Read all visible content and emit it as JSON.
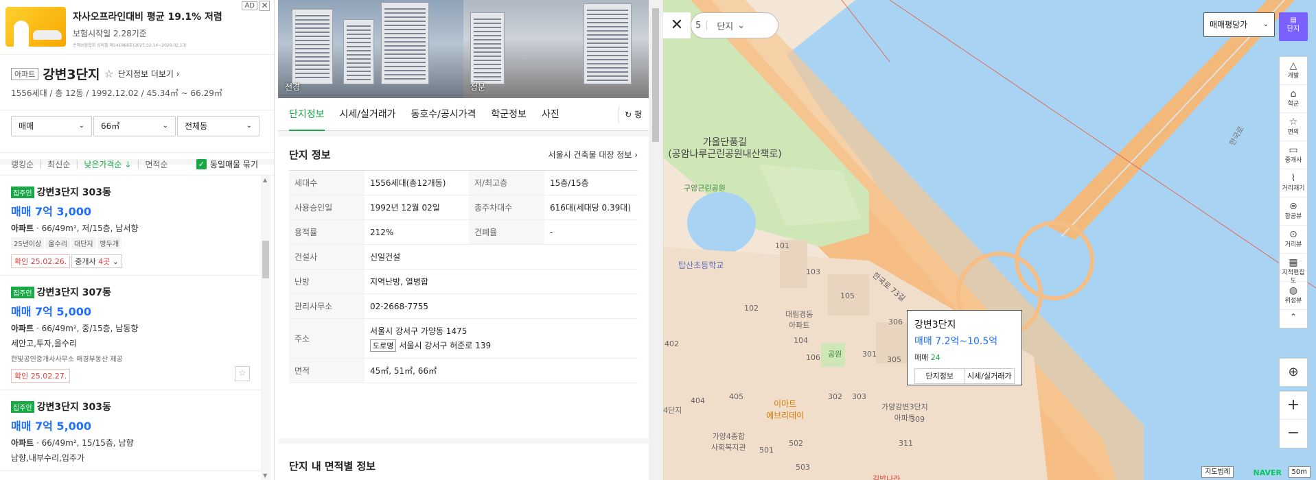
{
  "ad": {
    "title": "자사오프라인대비 평균 19.1% 저렴",
    "subtitle": "보험시작일 2.28기준",
    "fineprint": "손해보험협회 심의필 제141868호(2025.02.14~2026.02.13)",
    "badge": "AD",
    "close": "✕"
  },
  "complex": {
    "type_tag": "아파트",
    "name": "강변3단지",
    "star": "☆",
    "more_link": "단지정보 더보기 ›",
    "spec": "1556세대 / 총 12동 / 1992.12.02 / 45.34㎡ ~ 66.29㎡"
  },
  "filters": {
    "trade": "매매",
    "area": "66㎡",
    "building": "전체동",
    "chevron": "⌄"
  },
  "sort": {
    "ranking": "랭킹순",
    "recent": "최신순",
    "low_price": "낮은가격순 ↓",
    "area_sort": "면적순",
    "group_label": "동일매물 묶기",
    "check": "✓"
  },
  "listings": [
    {
      "owner": "집주인",
      "title": "강변3단지 303동",
      "price": "매매 7억 3,000",
      "spec_type": "아파트",
      "spec": " · 66/49m², 저/15층, 남서향",
      "tags": [
        "25년이상",
        "올수리",
        "대단지",
        "방두개"
      ],
      "desc": "",
      "agent": "",
      "confirm": "확인 25.02.26.",
      "broker_pre": "중개사 ",
      "broker_count": "4곳",
      "broker_post": " ⌄",
      "fav": ""
    },
    {
      "owner": "집주인",
      "title": "강변3단지 307동",
      "price": "매매 7억 5,000",
      "spec_type": "아파트",
      "spec": " · 66/49m², 중/15층, 남동향",
      "tags": [],
      "desc": "세안고,투자,올수리",
      "agent": "한빛공인중개사사무소    매경부동산 제공",
      "confirm": "확인 25.02.27.",
      "broker_pre": "",
      "broker_count": "",
      "broker_post": "",
      "fav": "☆"
    },
    {
      "owner": "집주인",
      "title": "강변3단지 303동",
      "price": "매매 7억 5,000",
      "spec_type": "아파트",
      "spec": " · 66/49m², 15/15층, 남향",
      "tags": [],
      "desc": "남향,내부수리,입주가",
      "agent": "",
      "confirm": "",
      "broker_pre": "",
      "broker_count": "",
      "broker_post": "",
      "fav": ""
    }
  ],
  "photos": [
    {
      "caption": "전경"
    },
    {
      "caption": "정문"
    }
  ],
  "tabs": [
    "단지정보",
    "시세/실거래가",
    "동호수/공시가격",
    "학군정보",
    "사진"
  ],
  "refresh_label": "↻ 평",
  "info": {
    "heading": "단지 정보",
    "link": "서울시 건축물 대장 정보 ›",
    "rows": [
      {
        "k1": "세대수",
        "v1": "1556세대(총12개동)",
        "k2": "저/최고층",
        "v2": "15층/15층"
      },
      {
        "k1": "사용승인일",
        "v1": "1992년 12월 02일",
        "k2": "총주차대수",
        "v2": "616대(세대당 0.39대)"
      },
      {
        "k1": "용적률",
        "v1": "212%",
        "k2": "건폐율",
        "v2": "-"
      },
      {
        "k1": "건설사",
        "v1": "신일건설"
      },
      {
        "k1": "난방",
        "v1": "지역난방, 열병합"
      },
      {
        "k1": "관리사무소",
        "v1": "02-2668-7755"
      },
      {
        "k1": "주소",
        "v1": "서울시 강서구 가양동 1475",
        "road_tag": "도로명",
        "v1b": "서울시 강서구 허준로 139"
      },
      {
        "k1": "면적",
        "v1": "45㎡, 51㎡, 66㎡"
      }
    ]
  },
  "area_section": {
    "heading": "단지 내 면적별 정보"
  },
  "map": {
    "close": "✕",
    "filter_partial": "5",
    "filter_danji": "단지",
    "chevron": "⌄",
    "price_select": "매매평당가",
    "danji_btn": "단지",
    "tools": [
      {
        "icon": "△",
        "label": "개발"
      },
      {
        "icon": "⌂",
        "label": "학군"
      },
      {
        "icon": "☆",
        "label": "편의"
      },
      {
        "icon": "▭",
        "label": "중개사"
      },
      {
        "icon": "⌇",
        "label": "거리재기"
      },
      {
        "icon": "⊜",
        "label": "항공뷰"
      },
      {
        "icon": "⊙",
        "label": "거리뷰"
      },
      {
        "icon": "▦",
        "label": "지적편집도"
      },
      {
        "icon": "◍",
        "label": "위성뷰"
      },
      {
        "icon": "⌃",
        "label": ""
      }
    ],
    "locate": "⊕",
    "zoom_in": "+",
    "zoom_out": "−",
    "labels": {
      "park_trail": "가을단풍길\n(공암나루근린공원내산책로)",
      "guam_park": "구암근린공원",
      "school": "탑산초등학교",
      "apt1": "대림경동\n아파트",
      "apt2": "가양강변3단지\n아파트",
      "emart": "이마트\n에브리데이",
      "welfare": "가양4종합\n사회복지관",
      "park": "공원",
      "road": "한국로 73길",
      "river_road": "한국로",
      "kimbap": "김밥나라",
      "b101": "101",
      "b102": "102",
      "b103": "103",
      "b104": "104",
      "b105": "105",
      "b106": "106",
      "b301": "301",
      "b302": "302",
      "b303": "303",
      "b305": "305",
      "b306": "306",
      "b309": "309",
      "b311": "311",
      "b402": "402",
      "b404": "404",
      "b405": "405",
      "b501": "501",
      "b502": "502",
      "b503": "503",
      "b4": "4단지"
    },
    "popup": {
      "name": "강변3단지",
      "price": "매매 7.2억~10.5억",
      "count_label": "매매 ",
      "count": "24",
      "btn_info": "단지정보",
      "btn_price": "시세/실거래가"
    },
    "legend": "지도범례",
    "logo": "NAVER",
    "scale": "50m"
  }
}
